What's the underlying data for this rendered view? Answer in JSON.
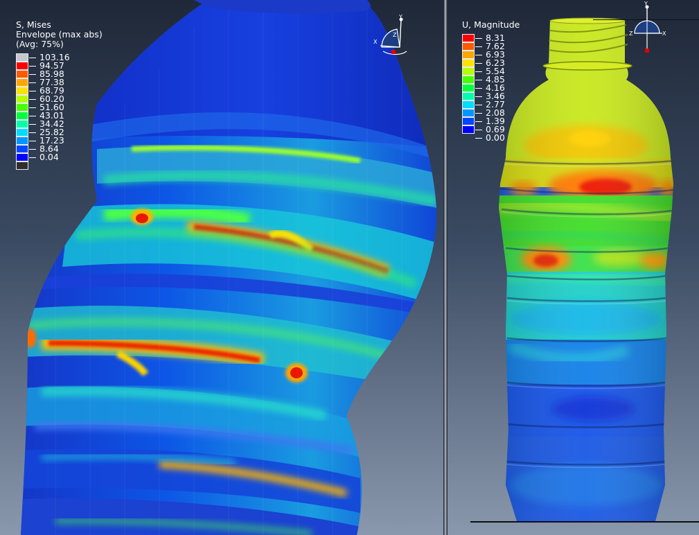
{
  "left_view": {
    "legend": {
      "variable": "S, Mises",
      "qualifier": "Envelope (max abs)",
      "averaging": "(Avg: 75%)",
      "values": [
        "103.16",
        "94.57",
        "85.98",
        "77.38",
        "68.79",
        "60.20",
        "51.60",
        "43.01",
        "34.42",
        "25.82",
        "17.23",
        "8.64",
        "0.04"
      ],
      "colors": [
        "#c4c8cc",
        "#ff0000",
        "#ff5a00",
        "#ffa500",
        "#ffe100",
        "#b4ff00",
        "#46ff00",
        "#00ff3c",
        "#00ffaa",
        "#00dcff",
        "#0096ff",
        "#0046ff",
        "#0000ff",
        "#2e2e2e"
      ]
    },
    "triad": {
      "x": "X",
      "y": "Y",
      "z": "Z"
    }
  },
  "right_view": {
    "legend": {
      "variable": "U, Magnitude",
      "values": [
        "8.31",
        "7.62",
        "6.93",
        "6.23",
        "5.54",
        "4.85",
        "4.16",
        "3.46",
        "2.77",
        "2.08",
        "1.39",
        "0.69",
        "0.00"
      ],
      "colors": [
        "#ff0000",
        "#ff5a00",
        "#ffa500",
        "#ffe100",
        "#b4ff00",
        "#46ff00",
        "#00ff3c",
        "#00ffaa",
        "#00dcff",
        "#0096ff",
        "#0046ff",
        "#0000ff"
      ]
    },
    "triad": {
      "x": "X",
      "y": "Y",
      "z": "Z"
    }
  }
}
